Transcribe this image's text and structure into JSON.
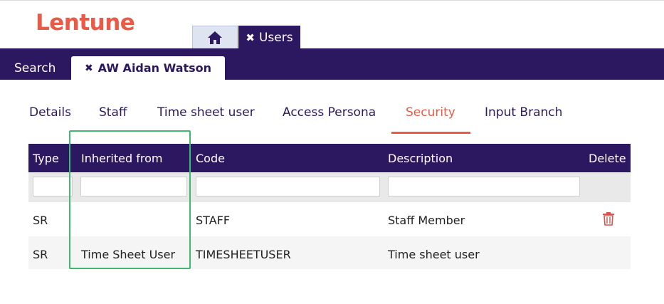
{
  "brand": {
    "logo_text": "Lentune",
    "logo_color": "#ea5a47"
  },
  "main_tabs": {
    "home_icon": "home-icon",
    "users_label": "Users",
    "close_glyph": "✖"
  },
  "nav": {
    "search_label": "Search",
    "person_tab_label": "AW Aidan Watson"
  },
  "sub_tabs": [
    "Details",
    "Staff",
    "Time sheet user",
    "Access Persona",
    "Security",
    "Input Branch"
  ],
  "active_sub_tab": "Security",
  "table": {
    "headers": {
      "type": "Type",
      "inherited": "Inherited from",
      "code": "Code",
      "description": "Description",
      "delete": "Delete"
    },
    "filters": {
      "type": "",
      "inherited": "",
      "code": "",
      "description": ""
    },
    "rows": [
      {
        "type": "SR",
        "inherited": "",
        "code": "STAFF",
        "description": "Staff Member",
        "deletable": true
      },
      {
        "type": "SR",
        "inherited": "Time Sheet User",
        "code": "TIMESHEETUSER",
        "description": "Time sheet user",
        "deletable": false
      }
    ]
  },
  "colors": {
    "primary": "#2b1860",
    "accent": "#ea5a47",
    "highlight": "#3dba6f",
    "delete": "#d9534f"
  }
}
